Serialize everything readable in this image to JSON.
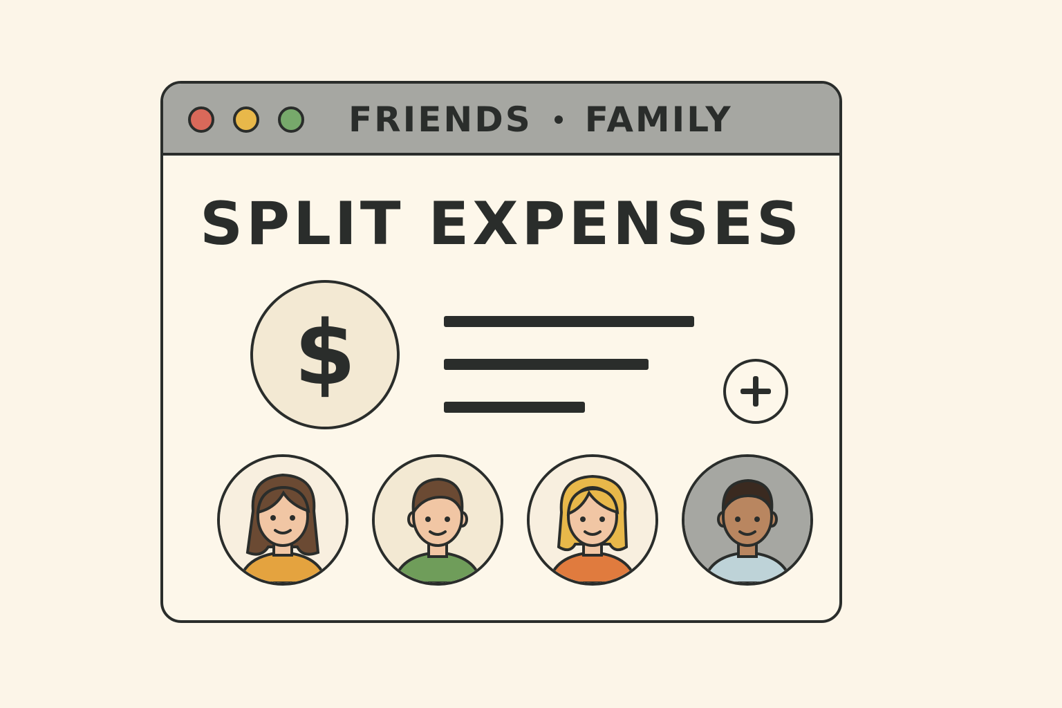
{
  "window": {
    "controls": {
      "close_color": "#d9695a",
      "minimize_color": "#e8b84a",
      "maximize_color": "#77a96b"
    },
    "tabs": [
      {
        "label": "FRIENDS"
      },
      {
        "label": "FAMILY"
      }
    ]
  },
  "main": {
    "title": "SPLIT EXPENSES",
    "expense_icon": {
      "icon": "dollar-icon",
      "symbol": "$",
      "background": "#f3e9d3"
    },
    "add_button": {
      "icon": "plus-icon"
    },
    "members": [
      {
        "icon": "woman-brown-hair-avatar",
        "shirt_color": "#e4a33f",
        "background": "#f8efdf"
      },
      {
        "icon": "man-brown-hair-avatar",
        "shirt_color": "#6f9d5a",
        "background": "#f3e9d3"
      },
      {
        "icon": "woman-blonde-hair-avatar",
        "shirt_color": "#e07b3e",
        "background": "#f8efdf"
      },
      {
        "icon": "man-dark-hair-avatar",
        "shirt_color": "#bed3d8",
        "background": "#a6a7a2"
      }
    ]
  }
}
